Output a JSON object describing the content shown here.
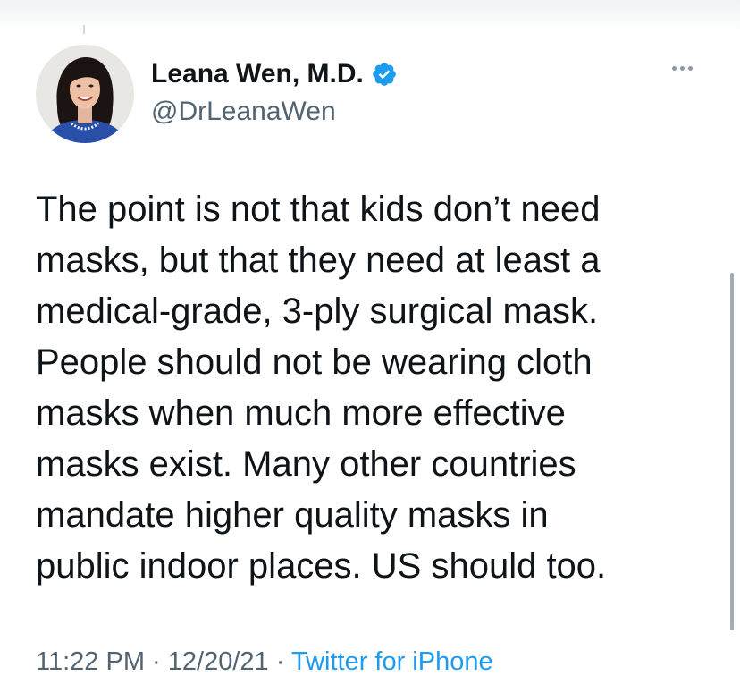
{
  "author": {
    "display_name": "Leana Wen, M.D.",
    "handle": "@DrLeanaWen",
    "verified_icon": "verified-badge-icon",
    "avatar_alt": "profile photo"
  },
  "menu": {
    "icon": "more-horizontal-icon"
  },
  "tweet": {
    "lines": [
      "The point is not that kids don’t need",
      "masks, but that they need at least a",
      "medical-grade, 3-ply surgical mask.",
      "People should not be wearing cloth",
      "masks when much more effective",
      "masks exist. Many other countries",
      "mandate higher quality masks in",
      "public indoor places. US should too."
    ]
  },
  "meta": {
    "time": "11:22 PM",
    "separator": "·",
    "date": "12/20/21",
    "source": "Twitter for iPhone"
  },
  "colors": {
    "text": "#0f1419",
    "secondary": "#536471",
    "accent": "#1d9bf0",
    "scrollbar": "#a7acb0"
  }
}
